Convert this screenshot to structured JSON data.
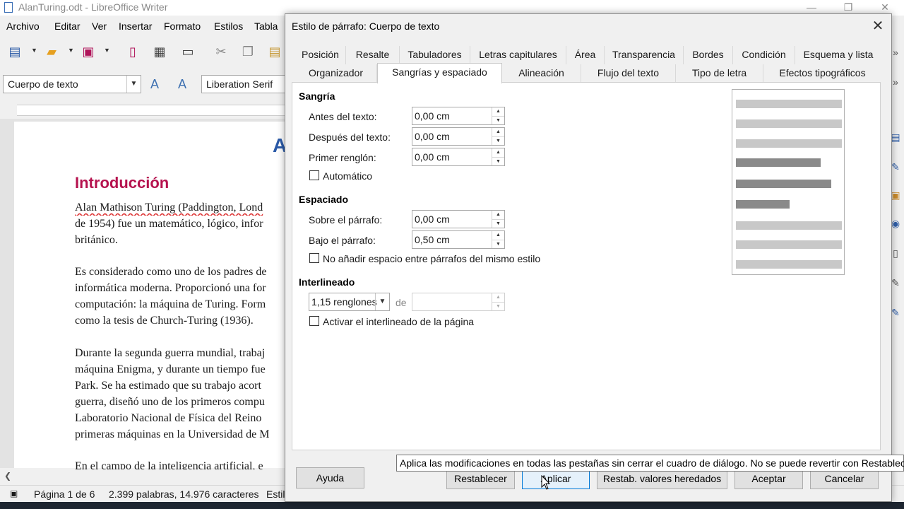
{
  "window": {
    "title": "AlanTuring.odt - LibreOffice Writer"
  },
  "menu": [
    "Archivo",
    "Editar",
    "Ver",
    "Insertar",
    "Formato",
    "Estilos",
    "Tabla"
  ],
  "toolbar": {
    "style_combo": "Cuerpo de texto",
    "font_combo": "Liberation Serif"
  },
  "document": {
    "title_fragment": "A",
    "heading": "Introducción",
    "lines": [
      "Alan Mathison Turing (Paddington, Lond",
      "de 1954) fue un matemático, lógico, infor",
      "británico.",
      "Es considerado como uno de los padres de",
      "informática moderna. Proporcionó una for",
      "computación: la máquina de Turing. Form",
      "como la tesis de Church-Turing (1936).",
      "Durante la segunda guerra mundial, trabaj",
      "máquina Enigma, y durante un tiempo fue",
      "Park. Se ha estimado que su trabajo acort",
      "guerra, diseñó uno de los primeros compu",
      "Laboratorio Nacional de Física del Reino",
      "primeras máquinas en la Universidad de M",
      "En el campo de la inteligencia artificial, e"
    ]
  },
  "status": {
    "page": "Página 1 de 6",
    "words": "2.399 palabras, 14.976 caracteres",
    "style": "Estil"
  },
  "dialog": {
    "title": "Estilo de párrafo: Cuerpo de texto",
    "tabs_row1": [
      "Posición",
      "Resalte",
      "Tabuladores",
      "Letras capitulares",
      "Área",
      "Transparencia",
      "Bordes",
      "Condición",
      "Esquema y lista"
    ],
    "tabs_row2": [
      "Organizador",
      "Sangrías y espaciado",
      "Alineación",
      "Flujo del texto",
      "Tipo de letra",
      "Efectos tipográficos"
    ],
    "active_tab": "Sangrías y espaciado",
    "indent": {
      "title": "Sangría",
      "before_label": "Antes del texto:",
      "before_value": "0,00 cm",
      "after_label": "Después del texto:",
      "after_value": "0,00 cm",
      "first_label": "Primer renglón:",
      "first_value": "0,00 cm",
      "auto_label": "Automático"
    },
    "spacing": {
      "title": "Espaciado",
      "above_label": "Sobre el párrafo:",
      "above_value": "0,00 cm",
      "below_label": "Bajo el párrafo:",
      "below_value": "0,50 cm",
      "no_space_label": "No añadir espacio entre párrafos del mismo estilo"
    },
    "line_spacing": {
      "title": "Interlineado",
      "value": "1,15 renglones",
      "of_label": "de",
      "of_value": "",
      "page_line_label": "Activar el interlineado de la página"
    },
    "buttons": {
      "help": "Ayuda",
      "reset": "Restablecer",
      "apply": "Aplicar",
      "reset_inherited": "Restab. valores heredados",
      "ok": "Aceptar",
      "cancel": "Cancelar"
    },
    "tooltip": "Aplica las modificaciones en todas las pestañas sin cerrar el cuadro de diálogo. No se puede revertir con Restablecer."
  },
  "colors": {
    "heading": "#b5124e",
    "accent": "#2b5aa8",
    "focus": "#0078d7"
  }
}
